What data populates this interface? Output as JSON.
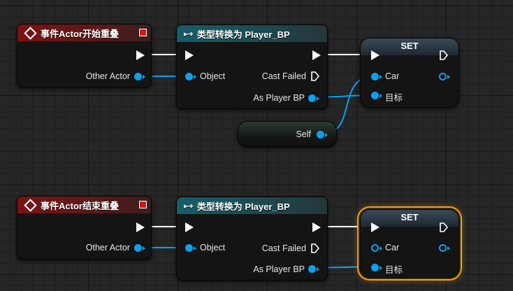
{
  "colors": {
    "exec": "#ffffff",
    "object_pin": "#0aa2f0",
    "event_header": "#7a1414",
    "cast_header": "#155e6a",
    "selection": "#f0a020"
  },
  "graph1": {
    "event": {
      "title": "事件Actor开始重叠",
      "other_actor": "Other Actor"
    },
    "cast": {
      "title": "类型转换为 Player_BP",
      "object": "Object",
      "cast_failed": "Cast Failed",
      "as_player_bp": "As Player BP"
    },
    "set": {
      "title": "SET",
      "var": "Car",
      "target": "目标"
    },
    "self": {
      "label": "Self"
    }
  },
  "graph2": {
    "event": {
      "title": "事件Actor结束重叠",
      "other_actor": "Other Actor"
    },
    "cast": {
      "title": "类型转换为 Player_BP",
      "object": "Object",
      "cast_failed": "Cast Failed",
      "as_player_bp": "As Player BP"
    },
    "set": {
      "title": "SET",
      "var": "Car",
      "target": "目标"
    }
  }
}
